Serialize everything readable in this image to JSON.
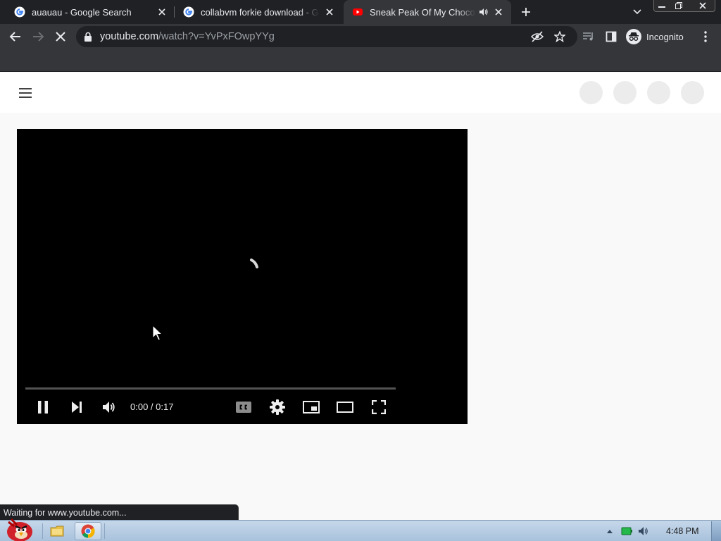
{
  "browser": {
    "tabs": [
      {
        "title": "auauau - Google Search",
        "favicon": "google-g-icon",
        "active": false
      },
      {
        "title": "collabvm forkie download - Google Search",
        "favicon": "google-g-icon",
        "active": false
      },
      {
        "title": "Sneak Peak Of My Chocolate",
        "favicon": "youtube-loading-icon",
        "active": true,
        "audio": true
      }
    ],
    "url_host": "youtube.com",
    "url_path": "/watch?v=YvPxFOwpYYg",
    "profile_label": "Incognito",
    "status_text": "Waiting for www.youtube.com..."
  },
  "player": {
    "time_display": "0:00 / 0:17",
    "state": "loading",
    "progress": 0
  },
  "taskbar": {
    "clock": "4:48 PM",
    "pinned": [
      "angry-birds-start-icon",
      "explorer-folder-icon",
      "chrome-icon"
    ]
  },
  "colors": {
    "tab_strip": "#202124",
    "toolbar": "#35363a",
    "player_bg": "#000000",
    "page_bg": "#f9f9f9",
    "taskbar": "#b8cde3"
  }
}
